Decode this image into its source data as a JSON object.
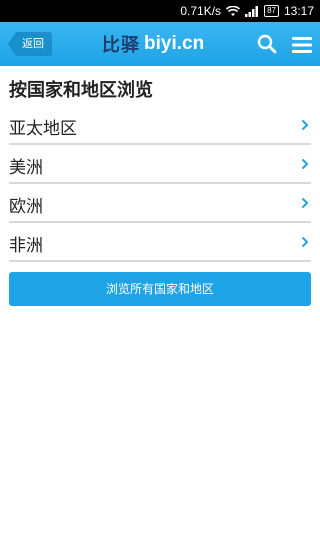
{
  "status_bar": {
    "net_speed": "0.71K/s",
    "battery_level": "87",
    "time": "13:17"
  },
  "header": {
    "back_label": "返回",
    "logo_cn": "比驿",
    "logo_en": "biyi.cn",
    "accent_color": "#1ea3e6"
  },
  "main": {
    "title": "按国家和地区浏览",
    "regions": [
      {
        "label": "亚太地区"
      },
      {
        "label": "美洲"
      },
      {
        "label": "欧洲"
      },
      {
        "label": "非洲"
      }
    ],
    "browse_all_label": "浏览所有国家和地区"
  },
  "icons": {
    "wifi": "wifi-icon",
    "signal": "signal-icon",
    "battery": "battery-icon",
    "search": "search-icon",
    "menu": "menu-icon",
    "chevron": "chevron-right-icon"
  }
}
